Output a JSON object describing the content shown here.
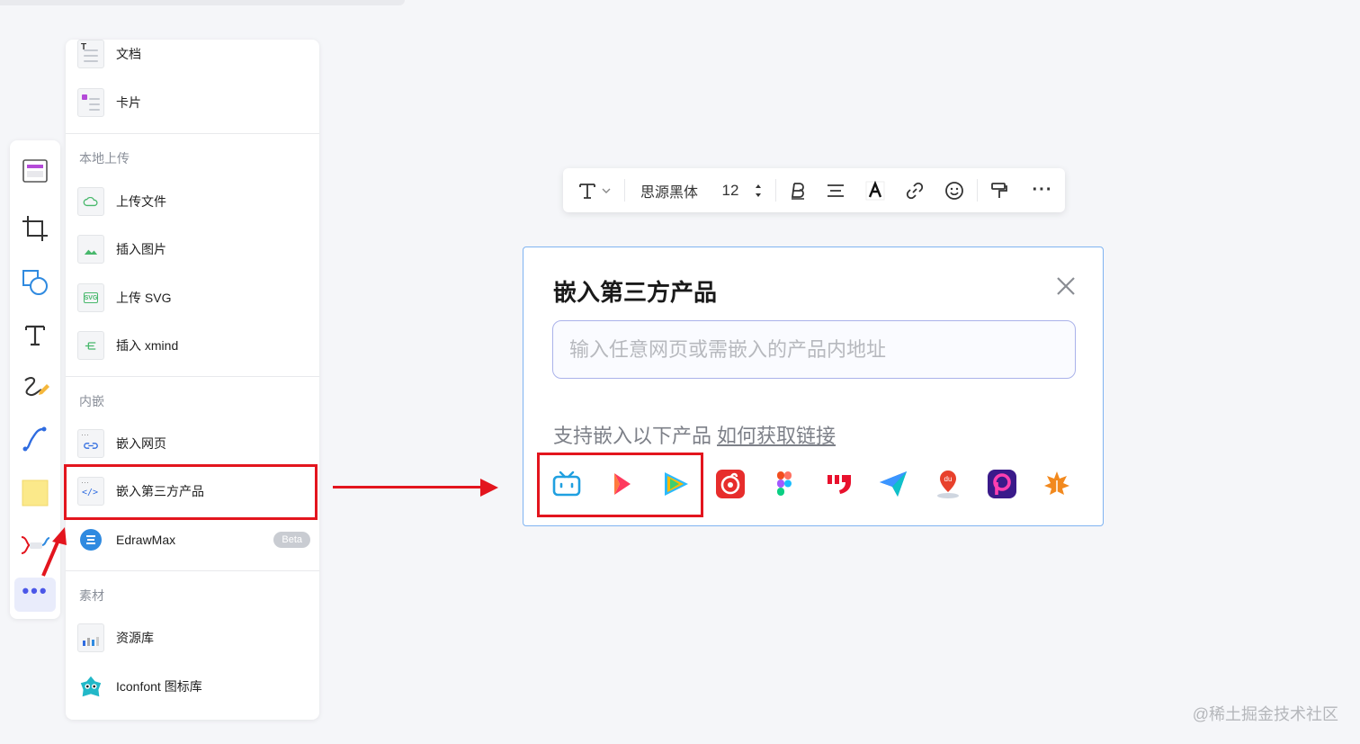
{
  "menu": {
    "top_items": [
      {
        "label": "文档",
        "icon": "doc-icon"
      },
      {
        "label": "卡片",
        "icon": "card-icon"
      }
    ],
    "section_local": "本地上传",
    "local_items": [
      {
        "label": "上传文件",
        "icon": "upload-file-icon"
      },
      {
        "label": "插入图片",
        "icon": "image-icon"
      },
      {
        "label": "上传 SVG",
        "icon": "svg-icon",
        "badge": "SVG"
      },
      {
        "label": "插入 xmind",
        "icon": "xmind-icon"
      }
    ],
    "section_embed": "内嵌",
    "embed_items": [
      {
        "label": "嵌入网页",
        "icon": "link-icon"
      },
      {
        "label": "嵌入第三方产品",
        "icon": "code-icon"
      },
      {
        "label": "EdrawMax",
        "icon": "edrawmax-icon",
        "badge": "Beta"
      }
    ],
    "section_material": "素材",
    "material_items": [
      {
        "label": "资源库",
        "icon": "library-icon"
      },
      {
        "label": "Iconfont 图标库",
        "icon": "iconfont-icon"
      }
    ]
  },
  "toolbar": {
    "items": [
      "frame-panel-icon",
      "crop-icon",
      "shape-icon",
      "text-icon",
      "pen-icon",
      "connector-icon",
      "sticky-note-icon",
      "mindmap-icon",
      "more-icon"
    ],
    "more_label": "•••"
  },
  "format_bar": {
    "font_name": "思源黑体",
    "font_size": "12",
    "more_label": "···"
  },
  "dialog": {
    "title": "嵌入第三方产品",
    "input_placeholder": "输入任意网页或需嵌入的产品内地址",
    "support_text": "支持嵌入以下产品",
    "help_link": "如何获取链接",
    "products": [
      "bilibili-icon",
      "kuaishou-icon",
      "tencent-video-icon",
      "netease-music-icon",
      "figma-icon",
      "jianshu-icon",
      "feishu-icon",
      "baidu-map-icon",
      "p-icon",
      "maple-icon"
    ]
  },
  "watermark": "@稀土掘金技术社区",
  "colors": {
    "accent": "#4b57e8",
    "highlight": "#e3151e",
    "dialog_border": "#7fb3f1"
  }
}
